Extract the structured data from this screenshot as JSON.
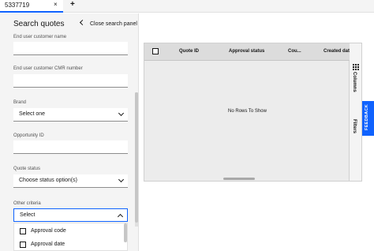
{
  "tabs": [
    {
      "label": "5337719",
      "close": "×"
    }
  ],
  "add_tab": "+",
  "panel": {
    "title": "Search quotes",
    "close_label": "Close search panel",
    "fields": {
      "end_user_customer_name": {
        "label": "End user customer name",
        "value": ""
      },
      "end_user_customer_cmr": {
        "label": "End user customer CMR number",
        "value": ""
      },
      "brand": {
        "label": "Brand",
        "value": "Select one"
      },
      "opportunity_id": {
        "label": "Opportunity ID",
        "value": ""
      },
      "quote_status": {
        "label": "Quote status",
        "value": "Choose status option(s)"
      },
      "other_criteria": {
        "label": "Other criteria",
        "value": "Select"
      }
    },
    "other_criteria_options": [
      {
        "label": "Approval code",
        "checked": false
      },
      {
        "label": "Approval date",
        "checked": false
      }
    ]
  },
  "grid": {
    "columns": [
      "Quote ID",
      "Approval status",
      "Cou...",
      "Created dat"
    ],
    "empty_text": "No Rows To Show",
    "side_tabs": {
      "columns": "Columns",
      "filters": "Filters"
    }
  },
  "feedback_label": "FEEDBACK",
  "colors": {
    "accent": "#0f62fe",
    "panel_bg": "#f4f4f4",
    "grid_bg": "#ececec"
  }
}
